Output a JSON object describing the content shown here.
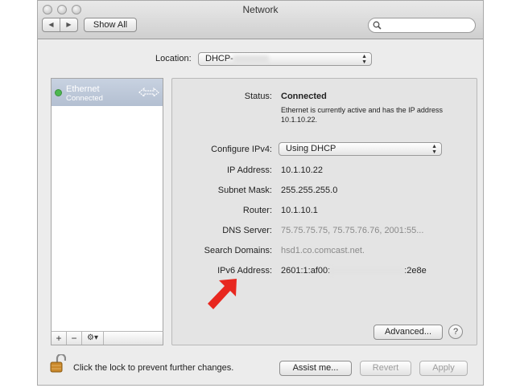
{
  "window": {
    "title": "Network"
  },
  "toolbar": {
    "back_icon": "back-arrow-icon",
    "forward_icon": "forward-arrow-icon",
    "show_all_label": "Show All",
    "search_icon": "magnifier-icon"
  },
  "location": {
    "label": "Location:",
    "value": "DHCP-"
  },
  "sidebar": {
    "items": [
      {
        "name": "Ethernet",
        "status": "Connected",
        "status_color": "#4cb84f",
        "icon": "ethernet-arrows-icon"
      }
    ],
    "add_label": "+",
    "remove_label": "−",
    "gear_label": "⚙▾"
  },
  "detail": {
    "status_label": "Status:",
    "status_value": "Connected",
    "status_description": "Ethernet is currently active and has the IP address 10.1.10.22.",
    "configure_label": "Configure IPv4:",
    "configure_value": "Using DHCP",
    "ip_label": "IP Address:",
    "ip_value": "10.1.10.22",
    "subnet_label": "Subnet Mask:",
    "subnet_value": "255.255.255.0",
    "router_label": "Router:",
    "router_value": "10.1.10.1",
    "dns_label": "DNS Server:",
    "dns_value": "75.75.75.75, 75.75.76.76, 2001:55...",
    "search_domains_label": "Search Domains:",
    "search_domains_value": "hsd1.co.comcast.net.",
    "ipv6_label": "IPv6 Address:",
    "ipv6_prefix": "2601:1:af00:",
    "ipv6_suffix": ":2e8e",
    "advanced_label": "Advanced...",
    "help_label": "?"
  },
  "footer": {
    "lock_icon": "unlocked-padlock-icon",
    "lock_text": "Click the lock to prevent further changes.",
    "assist_label": "Assist me...",
    "revert_label": "Revert",
    "apply_label": "Apply"
  },
  "annotation": {
    "icon": "red-arrow-icon",
    "color": "#e8271f"
  }
}
